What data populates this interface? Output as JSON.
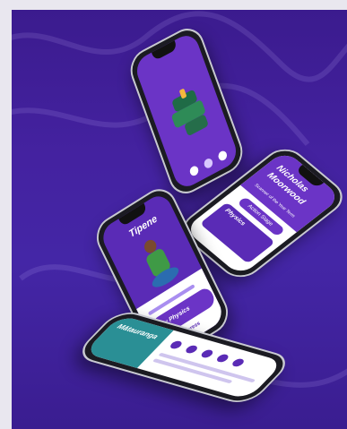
{
  "phones": {
    "top": {
      "nav": [
        "back",
        "menu"
      ]
    },
    "profile": {
      "title_line1": "Nicholas",
      "title_line2": "Moorwood",
      "sub_text": "Scanner of the Year Term",
      "button_label": "Action Stage",
      "section_label": "Physics"
    },
    "character": {
      "title": "Tipene",
      "level_label": "My Physics",
      "level_sub": "To do progress"
    },
    "lesson": {
      "title": "Mātauranga",
      "items": [
        "",
        "",
        "",
        "",
        ""
      ]
    }
  },
  "colors": {
    "purple": "#5a2bb6",
    "dark_purple": "#3b1b8e",
    "teal": "#2a8f95",
    "white": "#ffffff"
  }
}
